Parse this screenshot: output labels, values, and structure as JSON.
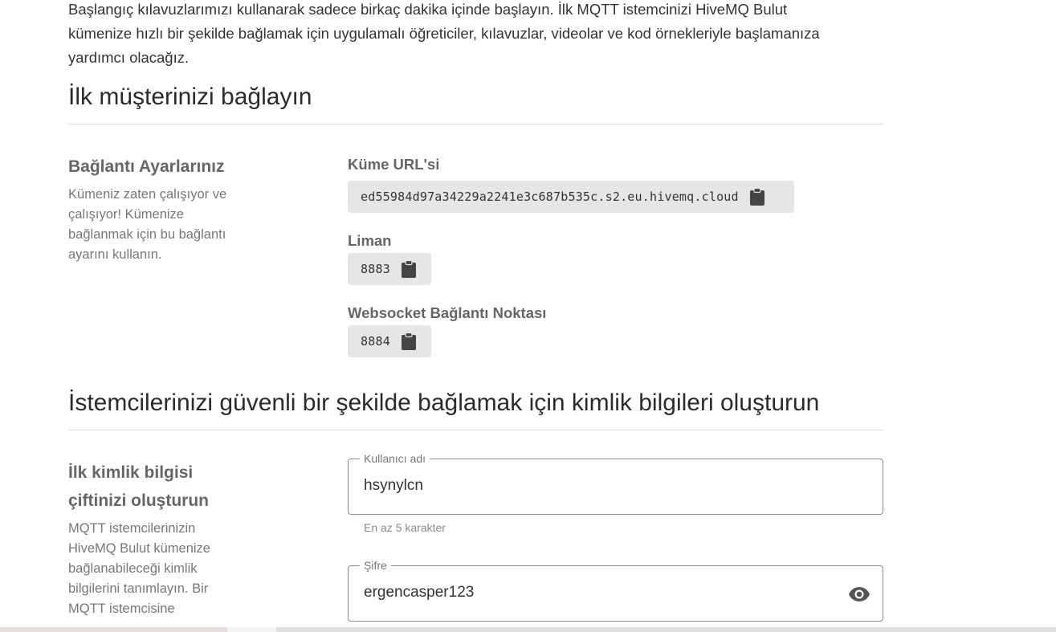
{
  "intro": {
    "line1": "Başlangıç kılavuzlarımızı kullanarak sadece birkaç dakika içinde başlayın. İlk MQTT istemcinizi HiveMQ Bulut",
    "line2": "kümenize hızlı bir şekilde bağlamak için uygulamalı öğreticiler, kılavuzlar, videolar ve kod örnekleriyle başlamanıza",
    "line3": "yardımcı olacağız."
  },
  "connect_section": {
    "heading": "İlk müşterinizi bağlayın",
    "left_title": "Bağlantı Ayarlarınız",
    "left_desc": "Kümeniz zaten çalışıyor ve çalışıyor! Kümenize bağlanmak için bu bağlantı ayarını kullanın.",
    "fields": [
      {
        "label": "Küme URL'si",
        "value": "ed55984d97a34229a2241e3c687b535c.s2.eu.hivemq.cloud",
        "icon": "clipboard-icon"
      },
      {
        "label": "Liman",
        "value": "8883",
        "icon": "clipboard-icon"
      },
      {
        "label": "Websocket Bağlantı Noktası",
        "value": "8884",
        "icon": "clipboard-icon"
      }
    ]
  },
  "credentials_section": {
    "heading": "İstemcilerinizi güvenli bir şekilde bağlamak için kimlik bilgileri oluşturun",
    "left_title_line1": "İlk kimlik bilgisi",
    "left_title_line2": "çiftinizi oluşturun",
    "left_desc": "MQTT istemcilerinizin HiveMQ Bulut kümenize bağlanabileceği kimlik bilgilerini tanımlayın. Bir MQTT istemcisine",
    "username": {
      "label": "Kullanıcı adı",
      "value": "hsynylcn",
      "helper": "En az 5 karakter"
    },
    "password": {
      "label": "Şifre",
      "value": "ergencasper123",
      "icon": "eye-icon"
    }
  },
  "colors": {
    "chip_bg": "#e6e6e6",
    "label": "#666666",
    "text": "#333333",
    "muted": "#777777"
  }
}
